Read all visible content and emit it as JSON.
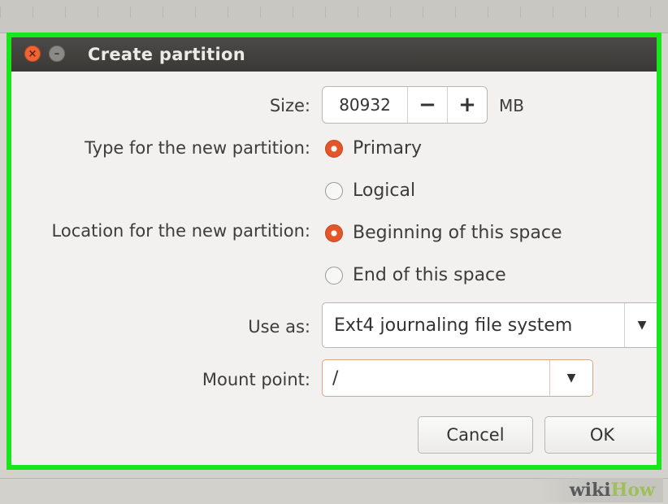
{
  "dialog": {
    "title": "Create partition",
    "size": {
      "label": "Size:",
      "value": "80932",
      "minus": "−",
      "plus": "+",
      "unit": "MB"
    },
    "type": {
      "label": "Type for the new partition:",
      "options": [
        {
          "label": "Primary",
          "selected": true
        },
        {
          "label": "Logical",
          "selected": false
        }
      ]
    },
    "location": {
      "label": "Location for the new partition:",
      "options": [
        {
          "label": "Beginning of this space",
          "selected": true
        },
        {
          "label": "End of this space",
          "selected": false
        }
      ]
    },
    "use_as": {
      "label": "Use as:",
      "value": "Ext4 journaling file system"
    },
    "mount": {
      "label": "Mount point:",
      "value": "/"
    },
    "buttons": {
      "cancel": "Cancel",
      "ok": "OK"
    }
  },
  "watermark": {
    "part1": "wiki",
    "part2": "How"
  },
  "colors": {
    "highlight": "#16e61a",
    "accent": "#e5552a",
    "titlebar": "#3c3b37"
  },
  "icons": [
    "close-icon",
    "minimize-icon",
    "dropdown-arrow-icon"
  ]
}
